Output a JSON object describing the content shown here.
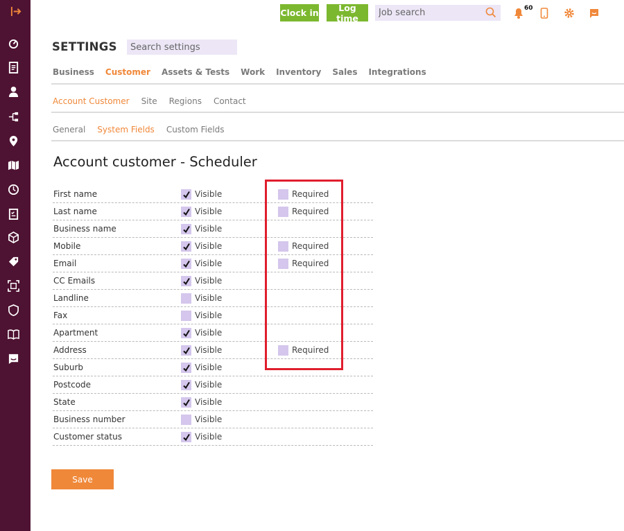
{
  "topbar": {
    "clock_in": "Clock in",
    "log_time": "Log time",
    "job_search_placeholder": "Job search",
    "notification_count": "60"
  },
  "settings": {
    "title": "SETTINGS",
    "search_placeholder": "Search settings"
  },
  "tabs_primary": [
    {
      "label": "Business",
      "active": false
    },
    {
      "label": "Customer",
      "active": true
    },
    {
      "label": "Assets & Tests",
      "active": false
    },
    {
      "label": "Work",
      "active": false
    },
    {
      "label": "Inventory",
      "active": false
    },
    {
      "label": "Sales",
      "active": false
    },
    {
      "label": "Integrations",
      "active": false
    }
  ],
  "tabs_secondary": [
    {
      "label": "Account Customer",
      "active": true
    },
    {
      "label": "Site",
      "active": false
    },
    {
      "label": "Regions",
      "active": false
    },
    {
      "label": "Contact",
      "active": false
    }
  ],
  "tabs_tertiary": [
    {
      "label": "General",
      "active": false
    },
    {
      "label": "System Fields",
      "active": true
    },
    {
      "label": "Custom Fields",
      "active": false
    }
  ],
  "section_title": "Account customer - Scheduler",
  "visible_label": "Visible",
  "required_label": "Required",
  "fields": [
    {
      "name": "First name",
      "visible": true,
      "has_required": true,
      "required": false
    },
    {
      "name": "Last name",
      "visible": true,
      "has_required": true,
      "required": false
    },
    {
      "name": "Business name",
      "visible": true,
      "has_required": false,
      "required": false
    },
    {
      "name": "Mobile",
      "visible": true,
      "has_required": true,
      "required": false
    },
    {
      "name": "Email",
      "visible": true,
      "has_required": true,
      "required": false
    },
    {
      "name": "CC Emails",
      "visible": true,
      "has_required": false,
      "required": false
    },
    {
      "name": "Landline",
      "visible": false,
      "has_required": false,
      "required": false
    },
    {
      "name": "Fax",
      "visible": false,
      "has_required": false,
      "required": false
    },
    {
      "name": "Apartment",
      "visible": true,
      "has_required": false,
      "required": false
    },
    {
      "name": "Address",
      "visible": true,
      "has_required": true,
      "required": false
    },
    {
      "name": "Suburb",
      "visible": true,
      "has_required": false,
      "required": false
    },
    {
      "name": "Postcode",
      "visible": true,
      "has_required": false,
      "required": false
    },
    {
      "name": "State",
      "visible": true,
      "has_required": false,
      "required": false
    },
    {
      "name": "Business number",
      "visible": false,
      "has_required": false,
      "required": false
    },
    {
      "name": "Customer status",
      "visible": true,
      "has_required": false,
      "required": false
    }
  ],
  "save_label": "Save",
  "colors": {
    "sidebar": "#4e1232",
    "accent": "#f0883a",
    "green": "#7cb82f",
    "checkbox": "#d4c6ec",
    "highlight": "#e01e2d"
  }
}
